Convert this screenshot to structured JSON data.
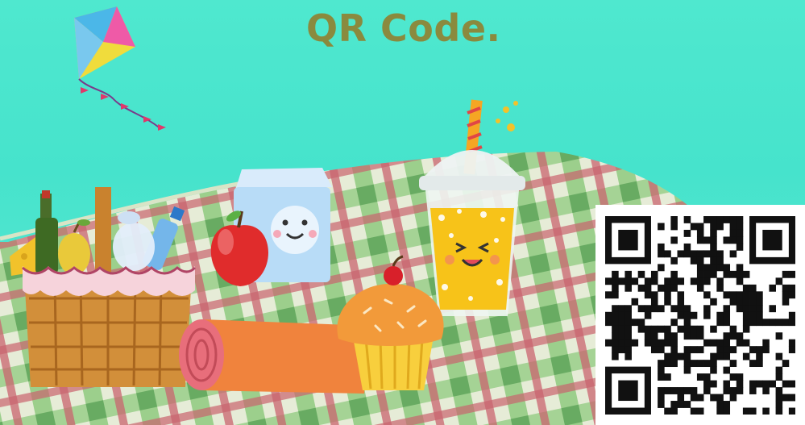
{
  "heading": "QR Code.",
  "colors": {
    "background": "#4fe8cf",
    "title": "#8a8a3e",
    "blanket_light": "#e6ecd7",
    "blanket_green": "#78bc6e",
    "blanket_red": "#c9646e",
    "qr_dark": "#111111"
  },
  "icons": [
    "kite-icon",
    "picnic-basket-icon",
    "milk-carton-icon",
    "apple-icon",
    "juice-cup-icon",
    "cupcake-icon",
    "rolled-mat-icon",
    "qr-code-icon"
  ]
}
